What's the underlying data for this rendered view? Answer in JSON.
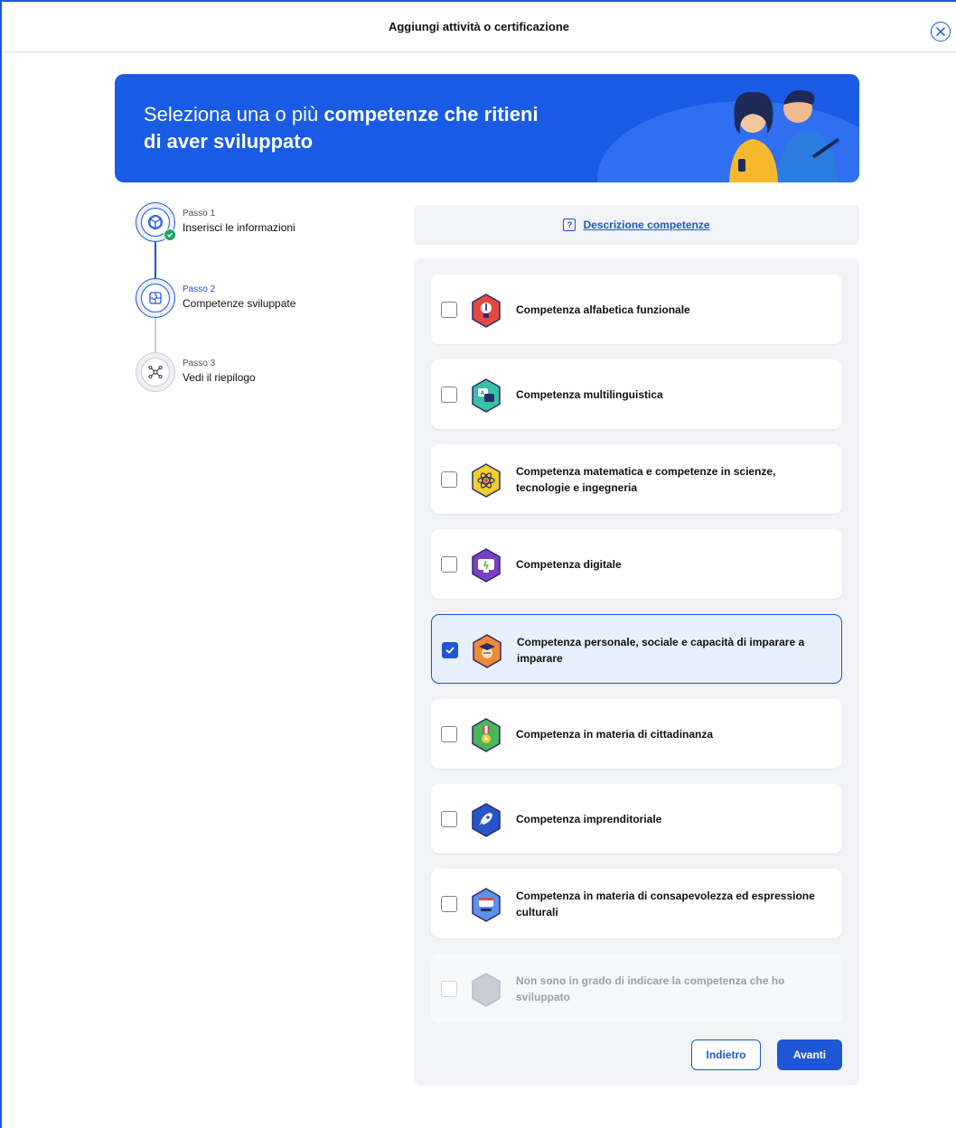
{
  "topbar": {
    "title": "Aggiungi attività o certificazione"
  },
  "hero": {
    "line1_normal": "Seleziona una o più ",
    "line1_bold": "competenze che ritieni",
    "line2_bold": "di aver sviluppato"
  },
  "steps": [
    {
      "small": "Passo 1",
      "label": "Inserisci le informazioni",
      "state": "done"
    },
    {
      "small": "Passo 2",
      "label": "Competenze sviluppate",
      "state": "active"
    },
    {
      "small": "Passo 3",
      "label": "Vedi il riepilogo",
      "state": "todo"
    }
  ],
  "description": {
    "icon_text": "?",
    "link_label": "Descrizione competenze"
  },
  "competences": [
    {
      "label": "Competenza alfabetica funzionale",
      "checked": false,
      "color": "#e5483f",
      "icon": "lightbulb-pen-icon"
    },
    {
      "label": "Competenza multilinguistica",
      "checked": false,
      "color": "#39c1a6",
      "icon": "languages-icon"
    },
    {
      "label": "Competenza matematica e competenze in scienze, tecnologie e ingegneria",
      "checked": false,
      "color": "#f1cf2c",
      "icon": "atom-icon"
    },
    {
      "label": "Competenza digitale",
      "checked": false,
      "color": "#7a3fc4",
      "icon": "monitor-icon"
    },
    {
      "label": "Competenza personale, sociale e capacità di imparare a imparare",
      "checked": true,
      "color": "#f08a3a",
      "icon": "graduation-icon"
    },
    {
      "label": "Competenza in materia di cittadinanza",
      "checked": false,
      "color": "#49b65a",
      "icon": "medal-icon"
    },
    {
      "label": "Competenza imprenditoriale",
      "checked": false,
      "color": "#2853c9",
      "icon": "rocket-icon"
    },
    {
      "label": "Competenza in materia di consapevolezza ed espressione culturali",
      "checked": false,
      "color": "#5d93e8",
      "icon": "theater-icon"
    },
    {
      "label": "Non sono in grado di indicare la competenza che ho sviluppato",
      "checked": false,
      "color": "#c9ced6",
      "icon": "empty-hexagon-icon",
      "disabled": true
    }
  ],
  "buttons": {
    "back": "Indietro",
    "next": "Avanti"
  }
}
